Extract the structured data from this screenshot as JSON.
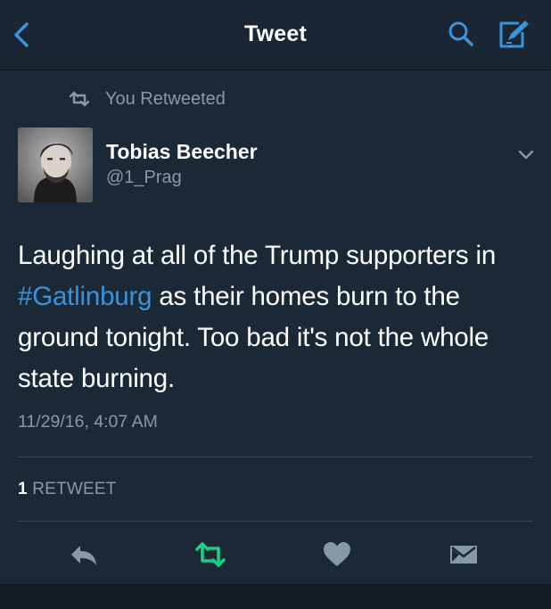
{
  "header": {
    "back_icon": "back-chevron-icon",
    "title": "Tweet",
    "search_icon": "search-icon",
    "compose_icon": "compose-icon"
  },
  "retweet_context": {
    "icon": "retweet-icon",
    "text": "You Retweeted"
  },
  "tweet": {
    "author": {
      "name": "Tobias Beecher",
      "handle": "@1_Prag",
      "avatar_icon": "avatar-photo"
    },
    "text_part1": "Laughing at all of the Trump supporters in ",
    "hashtag": "#Gatlinburg",
    "text_part2": " as their homes burn to the ground tonight. Too bad it's not the whole state burning.",
    "timestamp": "11/29/16, 4:07 AM",
    "stats": {
      "retweet_count": "1",
      "retweet_label": "RETWEET"
    }
  },
  "actions": [
    "reply-icon",
    "retweet-icon",
    "like-icon",
    "direct-message-icon"
  ],
  "colors": {
    "background": "#1b2836",
    "navbar": "#1a2633",
    "accent_blue": "#3b94d9",
    "retweet_green": "#19cf86",
    "muted_text": "#8899a6",
    "divider": "#38444d"
  }
}
